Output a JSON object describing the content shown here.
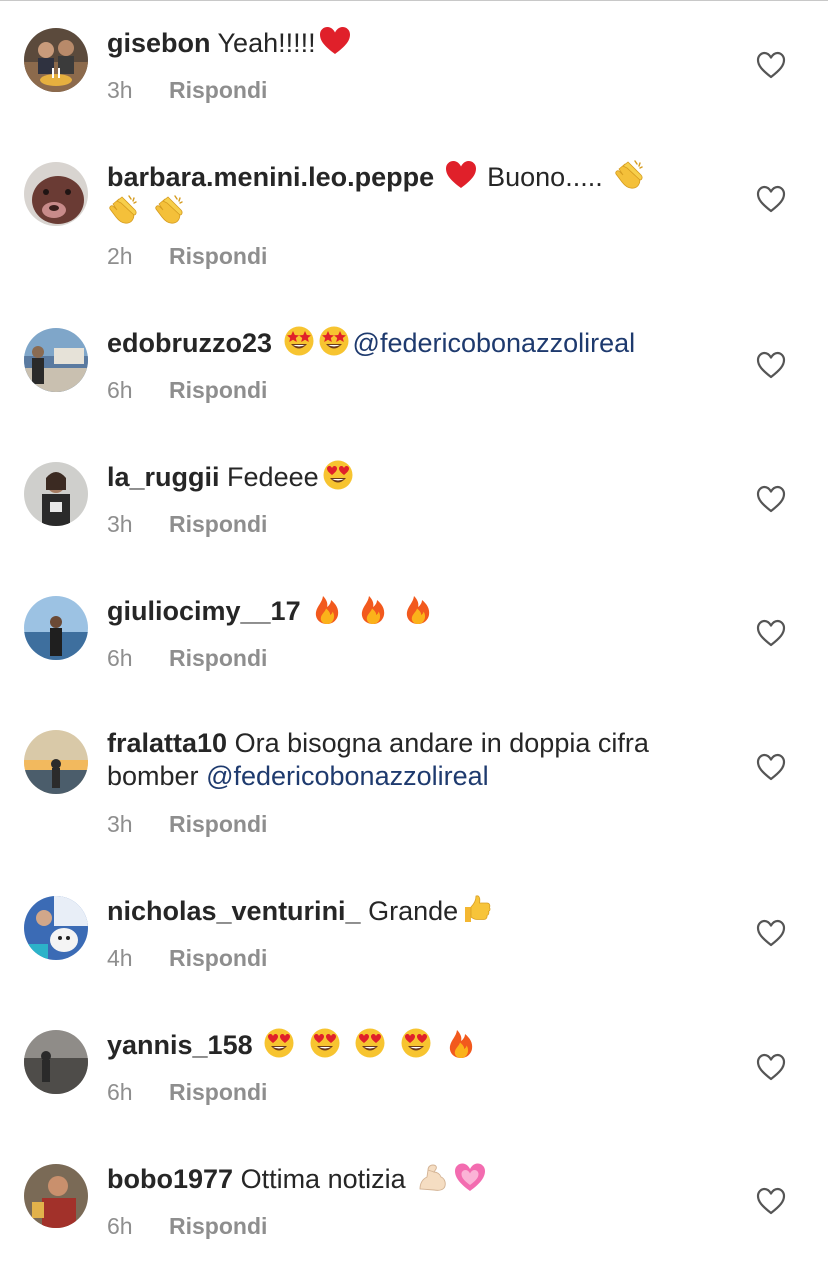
{
  "icons": {
    "like": "heart-outline-icon"
  },
  "colors": {
    "username": "#262626",
    "text": "#262626",
    "meta": "#8e8e8e",
    "mention": "#1e3a6e",
    "heart_emoji": "#e0202a"
  },
  "comments": [
    {
      "username": "gisebon",
      "text_before": "Yeah!!!!!",
      "emojis": [
        "red-heart"
      ],
      "time": "3h",
      "reply_label": "Rispondi"
    },
    {
      "username": "barbara.menini.leo.peppe",
      "text_before": "Buono.....",
      "emojis_before_text": [
        "red-heart"
      ],
      "emojis": [
        "clapping-hands",
        "clapping-hands",
        "clapping-hands"
      ],
      "time": "2h",
      "reply_label": "Rispondi"
    },
    {
      "username": "edobruzzo23",
      "emojis": [
        "star-struck",
        "star-struck"
      ],
      "mention": "@federicobonazzolireal",
      "time": "6h",
      "reply_label": "Rispondi"
    },
    {
      "username": "la_ruggii",
      "text_before": "Fedeee",
      "emojis": [
        "heart-eyes"
      ],
      "time": "3h",
      "reply_label": "Rispondi"
    },
    {
      "username": "giuliocimy__17",
      "emojis": [
        "fire",
        "fire",
        "fire"
      ],
      "time": "6h",
      "reply_label": "Rispondi"
    },
    {
      "username": "fralatta10",
      "text_before": "Ora bisogna andare in doppia cifra bomber",
      "mention": "@federicobonazzolireal",
      "time": "3h",
      "reply_label": "Rispondi"
    },
    {
      "username": "nicholas_venturini_",
      "text_before": "Grande",
      "emojis": [
        "thumbs-up"
      ],
      "time": "4h",
      "reply_label": "Rispondi"
    },
    {
      "username": "yannis_158",
      "emojis": [
        "heart-eyes",
        "heart-eyes",
        "heart-eyes",
        "heart-eyes",
        "fire"
      ],
      "time": "6h",
      "reply_label": "Rispondi"
    },
    {
      "username": "bobo1977",
      "text_before": "Ottima notizia",
      "emojis": [
        "flexed-biceps",
        "growing-heart"
      ],
      "time": "6h",
      "reply_label": "Rispondi"
    }
  ]
}
